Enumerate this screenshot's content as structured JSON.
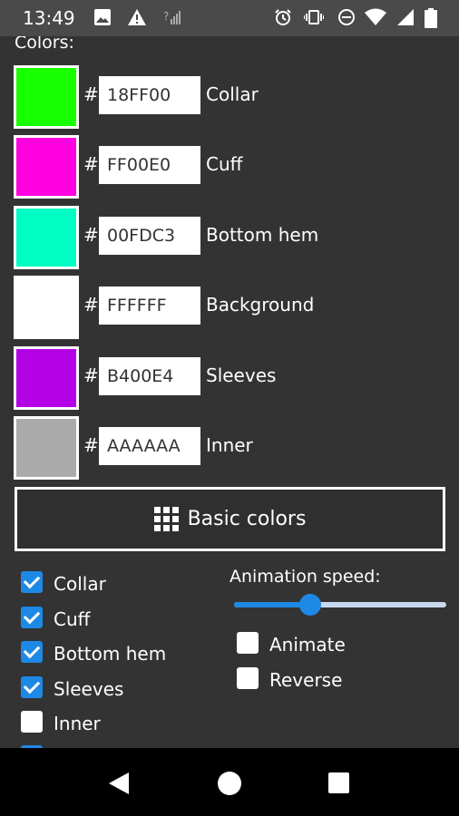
{
  "status_bar": {
    "time": "13:49",
    "left_icons": [
      "image-icon",
      "warning-icon",
      "signal-question-icon"
    ],
    "right_icons": [
      "alarm-icon",
      "vibrate-icon",
      "do-not-disturb-icon",
      "wifi-icon",
      "cell-signal-icon",
      "battery-icon"
    ]
  },
  "colors_section": {
    "title": "Colors:",
    "hash_symbol": "#",
    "rows": [
      {
        "label": "Collar",
        "hex": "18FF00",
        "swatch": "#18FF00"
      },
      {
        "label": "Cuff",
        "hex": "FF00E0",
        "swatch": "#FF00E0"
      },
      {
        "label": "Bottom hem",
        "hex": "00FDC3",
        "swatch": "#00FDC3"
      },
      {
        "label": "Background",
        "hex": "FFFFFF",
        "swatch": "#FFFFFF"
      },
      {
        "label": "Sleeves",
        "hex": "B400E4",
        "swatch": "#B400E4"
      },
      {
        "label": "Inner",
        "hex": "AAAAAA",
        "swatch": "#AAAAAA"
      }
    ]
  },
  "basic_colors_button": {
    "label": "Basic colors",
    "icon": "grid-icon"
  },
  "part_toggles": [
    {
      "label": "Collar",
      "checked": true
    },
    {
      "label": "Cuff",
      "checked": true
    },
    {
      "label": "Bottom hem",
      "checked": true
    },
    {
      "label": "Sleeves",
      "checked": true
    },
    {
      "label": "Inner",
      "checked": false
    }
  ],
  "animation": {
    "title": "Animation speed:",
    "speed_fraction": 0.36,
    "animate_label": "Animate",
    "animate_checked": false,
    "reverse_label": "Reverse",
    "reverse_checked": false
  },
  "accent_color": "#1E88E5",
  "navbar": {
    "icons": [
      "back-icon",
      "home-icon",
      "recents-icon"
    ]
  }
}
